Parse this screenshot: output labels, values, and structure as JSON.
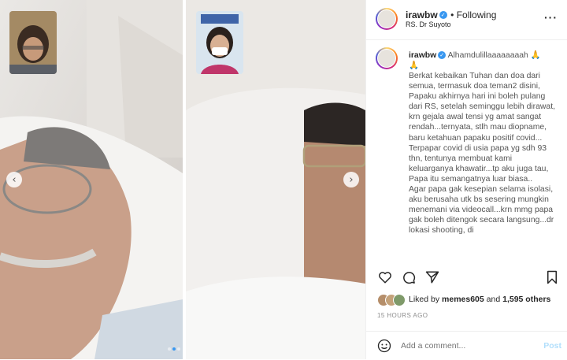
{
  "post": {
    "username": "irawbw",
    "following_label": "Following",
    "location": "RS. Dr Suyoto",
    "caption_first_line": "Alhamdulillaaaaaaaah 🙏",
    "caption_second_line": "🙏",
    "caption_body": "Berkat kebaikan Tuhan dan doa dari semua, termasuk doa teman2 disini, Papaku akhirnya hari ini boleh pulang dari RS, setelah seminggu lebih dirawat, krn gejala awal tensi yg amat sangat rendah...ternyata, stlh mau diopname, baru ketahuan papaku positif covid...\nTerpapar covid di usia papa yg sdh 93 thn, tentunya membuat kami keluarganya khawatir...tp aku juga tau, Papa itu semangatnya luar biasa..\nAgar papa gak kesepian selama isolasi, aku berusaha utk bs sesering mungkin menemani via videocall...krn mmg papa gak boleh ditengok secara langsung...dr lokasi shooting, di",
    "likes_prefix": "Liked by ",
    "likes_user": "memes605",
    "likes_and": " and ",
    "likes_others": "1,595 others",
    "timestamp": "15 HOURS AGO",
    "comment_placeholder": "Add a comment...",
    "post_button": "Post"
  },
  "media": {
    "prev_arrow": "‹",
    "next_arrow": "›",
    "slide_count": 3,
    "active_slide": 2
  },
  "colors": {
    "accent": "#3897f0",
    "post_button": "#b2dffc",
    "muted": "#8e8e8e"
  },
  "icons": [
    "verified-badge-icon",
    "more-options-icon",
    "heart-icon",
    "comment-icon",
    "share-icon",
    "bookmark-icon",
    "emoji-icon",
    "chevron-left-icon",
    "chevron-right-icon"
  ]
}
